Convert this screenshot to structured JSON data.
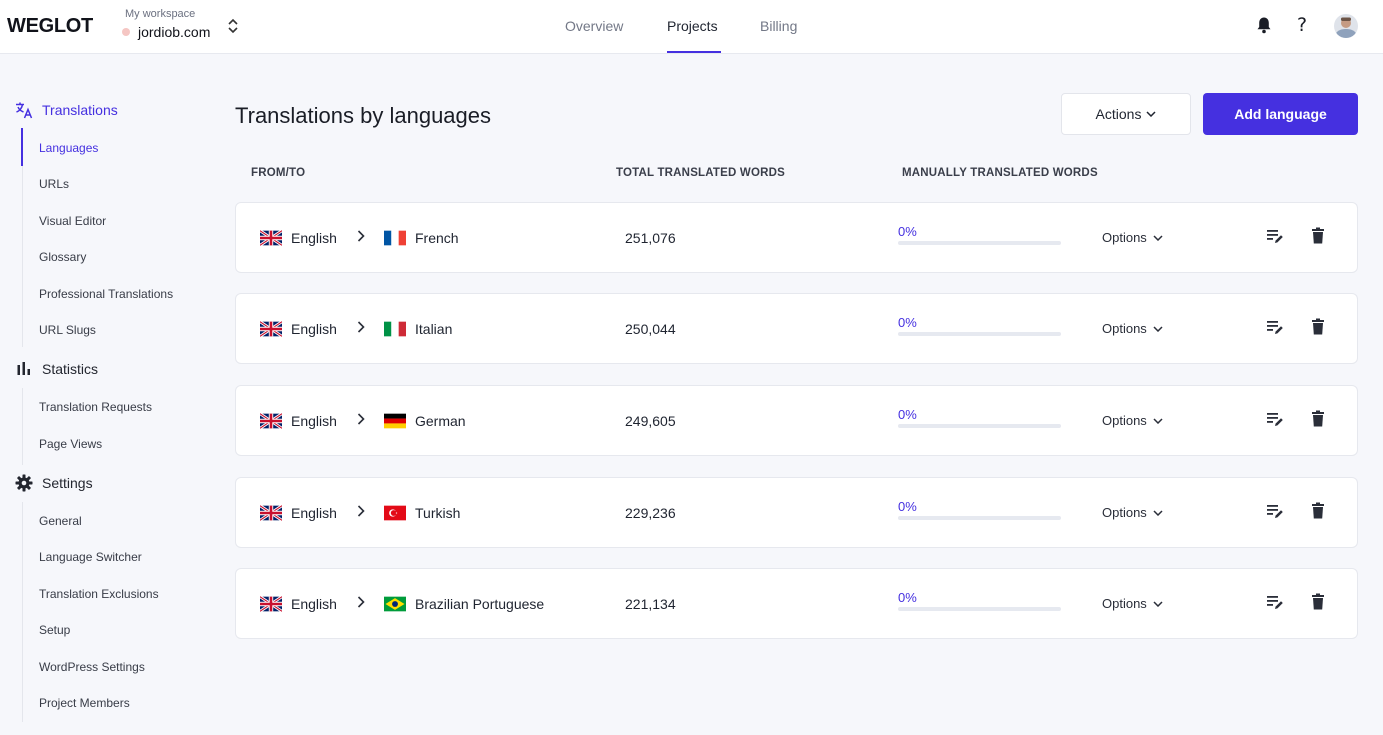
{
  "app": {
    "logo": "WEGLOT"
  },
  "workspace": {
    "label": "My workspace",
    "name": "jordiob.com"
  },
  "nav": {
    "tabs": [
      "Overview",
      "Projects",
      "Billing"
    ],
    "active": "Projects"
  },
  "sidebar": {
    "translations": {
      "title": "Translations",
      "items": [
        "Languages",
        "URLs",
        "Visual Editor",
        "Glossary",
        "Professional Translations",
        "URL Slugs"
      ]
    },
    "statistics": {
      "title": "Statistics",
      "items": [
        "Translation Requests",
        "Page Views"
      ]
    },
    "settings": {
      "title": "Settings",
      "items": [
        "General",
        "Language Switcher",
        "Translation Exclusions",
        "Setup",
        "WordPress Settings",
        "Project Members"
      ]
    }
  },
  "main": {
    "title": "Translations by languages",
    "actions_label": "Actions",
    "add_label": "Add language",
    "columns": {
      "from_to": "FROM/TO",
      "total": "TOTAL TRANSLATED WORDS",
      "manual": "MANUALLY TRANSLATED WORDS"
    },
    "options_label": "Options",
    "rows": [
      {
        "from": "English",
        "to": "French",
        "flag": "fr",
        "total": "251,076",
        "manual_pct_label": "0%",
        "manual_fraction": 0
      },
      {
        "from": "English",
        "to": "Italian",
        "flag": "it",
        "total": "250,044",
        "manual_pct_label": "0%",
        "manual_fraction": 0
      },
      {
        "from": "English",
        "to": "German",
        "flag": "de",
        "total": "249,605",
        "manual_pct_label": "0%",
        "manual_fraction": 0
      },
      {
        "from": "English",
        "to": "Turkish",
        "flag": "tr",
        "total": "229,236",
        "manual_pct_label": "0%",
        "manual_fraction": 0
      },
      {
        "from": "English",
        "to": "Brazilian Portuguese",
        "flag": "br",
        "total": "221,134",
        "manual_pct_label": "0%",
        "manual_fraction": 0
      }
    ]
  },
  "colors": {
    "accent": "#4530e0",
    "background": "#f6f7fb",
    "card": "#ffffff"
  }
}
